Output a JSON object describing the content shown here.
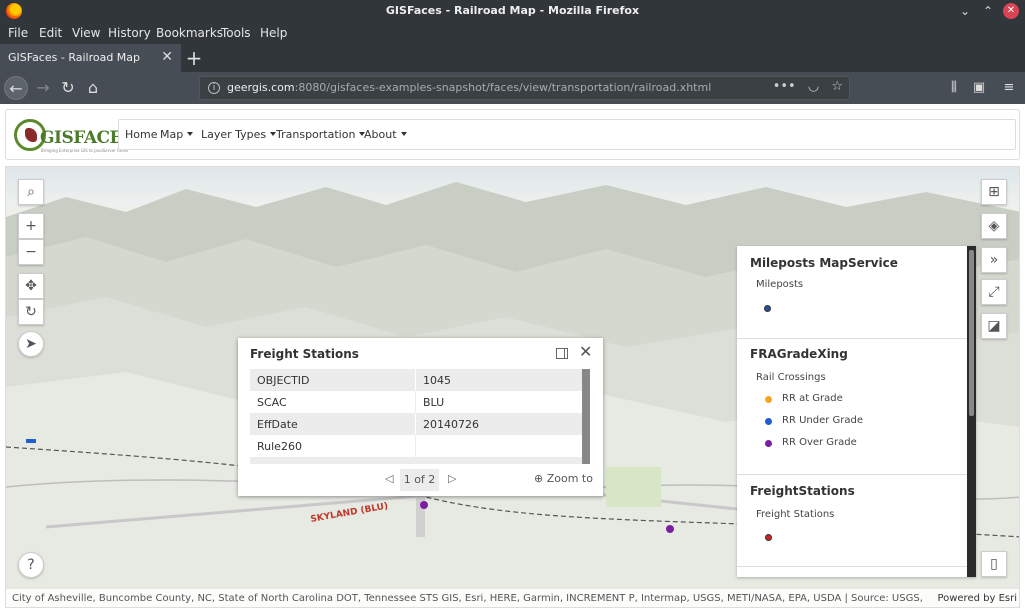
{
  "window": {
    "title": "GISFaces - Railroad Map - Mozilla Firefox"
  },
  "menu": [
    "File",
    "Edit",
    "View",
    "History",
    "Bookmarks",
    "Tools",
    "Help"
  ],
  "tab": {
    "label": "GISFaces - Railroad Map"
  },
  "urlbar": {
    "host": "geergis.com",
    "path": ":8080/gisfaces-examples-snapshot/faces/view/transportation/railroad.xhtml"
  },
  "site": {
    "logo_text": "GISFACES",
    "logo_tagline": "Bringing Enterprise GIS to JavaServer Faces",
    "nav": [
      "Home",
      "Map",
      "Layer Types",
      "Transportation",
      "About"
    ]
  },
  "popup": {
    "title": "Freight Stations",
    "rows": [
      {
        "key": "OBJECTID",
        "value": "1045"
      },
      {
        "key": "SCAC",
        "value": "BLU"
      },
      {
        "key": "EffDate",
        "value": "20140726"
      },
      {
        "key": "Rule260",
        "value": ""
      }
    ],
    "pager": "1 of 2",
    "zoom_to": "Zoom to"
  },
  "legend": {
    "sections": [
      {
        "title": "Mileposts MapService",
        "layer": "Mileposts",
        "items": [
          {
            "label": "",
            "color": "#1f4fa8"
          }
        ]
      },
      {
        "title": "FRAGradeXing",
        "layer": "Rail Crossings",
        "items": [
          {
            "label": "RR at Grade",
            "color": "#f5a623"
          },
          {
            "label": "RR Under Grade",
            "color": "#1f5fd0"
          },
          {
            "label": "RR Over Grade",
            "color": "#7b1fa2"
          }
        ]
      },
      {
        "title": "FreightStations",
        "layer": "Freight Stations",
        "items": [
          {
            "label": "",
            "color": "#d32020"
          }
        ]
      }
    ]
  },
  "attribution": {
    "text": "City of Asheville, Buncombe County, NC, State of North Carolina DOT, Tennessee STS GIS, Esri, HERE, Garmin, INCREMENT P, Intermap, USGS, METI/NASA, EPA, USDA | Source: USGS, NGA, N...",
    "powered": "Powered by Esri"
  }
}
